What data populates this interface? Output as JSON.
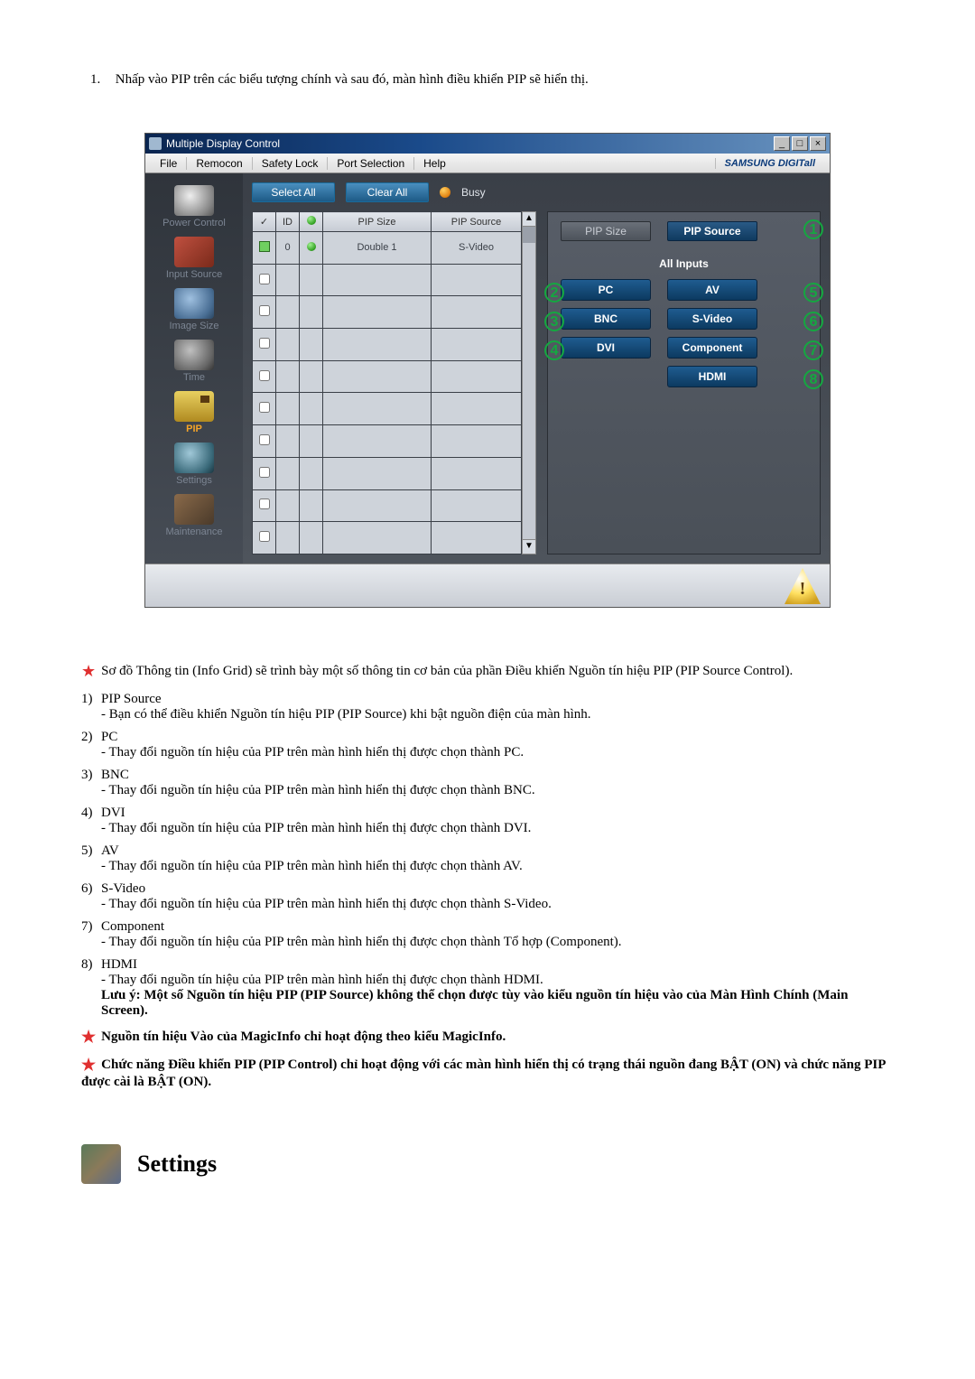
{
  "intro": {
    "num": "1.",
    "text": "Nhấp vào PIP trên các biểu tượng chính và sau đó, màn hình điều khiển PIP sẽ hiển thị."
  },
  "app": {
    "title": "Multiple Display Control",
    "menus": {
      "file": "File",
      "remocon": "Remocon",
      "safety_lock": "Safety Lock",
      "port_selection": "Port Selection",
      "help": "Help"
    },
    "brand": "SAMSUNG DIGITall",
    "winbuttons": {
      "min": "_",
      "max": "□",
      "close": "×"
    },
    "sidebar": {
      "power": "Power Control",
      "input": "Input Source",
      "imgsize": "Image Size",
      "time": "Time",
      "pip": "PIP",
      "settings": "Settings",
      "maintenance": "Maintenance"
    },
    "toolbar": {
      "select_all": "Select All",
      "clear_all": "Clear All",
      "busy": "Busy"
    },
    "grid": {
      "headers": {
        "chk": "✓",
        "id": "ID",
        "status": "●",
        "pip_size": "PIP Size",
        "pip_source": "PIP Source"
      },
      "row0": {
        "id": "0",
        "pip_size": "Double 1",
        "pip_source": "S-Video"
      }
    },
    "rightpane": {
      "tab_size": "PIP Size",
      "tab_source": "PIP Source",
      "all_inputs": "All Inputs",
      "btns": {
        "pc": "PC",
        "av": "AV",
        "bnc": "BNC",
        "svideo": "S-Video",
        "dvi": "DVI",
        "component": "Component",
        "hdmi": "HDMI"
      },
      "callouts": {
        "c1": "1",
        "c2": "2",
        "c3": "3",
        "c4": "4",
        "c5": "5",
        "c6": "6",
        "c7": "7",
        "c8": "8"
      }
    }
  },
  "notes": {
    "star_intro": "Sơ đồ Thông tin (Info Grid) sẽ trình bày một số thông tin cơ bản của phần Điều khiển Nguồn tín hiệu PIP (PIP Source Control).",
    "items": {
      "n1": {
        "num": "1)",
        "title": "PIP Source",
        "sub": "- Bạn có thể điều khiển Nguồn tín hiệu PIP (PIP Source) khi bật nguồn điện của màn hình."
      },
      "n2": {
        "num": "2)",
        "title": "PC",
        "sub": "- Thay đổi nguồn tín hiệu của PIP trên màn hình hiển thị được chọn thành PC."
      },
      "n3": {
        "num": "3)",
        "title": "BNC",
        "sub": "- Thay đổi nguồn tín hiệu của PIP trên màn hình hiển thị được chọn thành BNC."
      },
      "n4": {
        "num": "4)",
        "title": "DVI",
        "sub": "- Thay đổi nguồn tín hiệu của PIP trên màn hình hiển thị được chọn thành DVI."
      },
      "n5": {
        "num": "5)",
        "title": "AV",
        "sub": "- Thay đổi nguồn tín hiệu của PIP trên màn hình hiển thị được chọn thành AV."
      },
      "n6": {
        "num": "6)",
        "title": "S-Video",
        "sub": "- Thay đổi nguồn tín hiệu của PIP trên màn hình hiển thị được chọn thành S-Video."
      },
      "n7": {
        "num": "7)",
        "title": "Component",
        "sub": "- Thay đổi nguồn tín hiệu của PIP trên màn hình hiển thị được chọn thành Tổ hợp (Component)."
      },
      "n8": {
        "num": "8)",
        "title": "HDMI",
        "sub": "- Thay đổi nguồn tín hiệu của PIP trên màn hình hiển thị được chọn thành HDMI."
      }
    },
    "warning": "Lưu ý: Một số Nguồn tín hiệu PIP (PIP Source) không thể chọn được tùy vào kiểu nguồn tín hiệu vào của Màn Hình Chính (Main Screen).",
    "star_magicinfo": "Nguồn tín hiệu Vào của MagicInfo chỉ hoạt động theo kiểu MagicInfo.",
    "star_pipcontrol": "Chức năng Điều khiển PIP (PIP Control) chỉ hoạt động với các màn hình hiển thị có trạng thái nguồn đang BẬT (ON) và chức năng PIP được cài là BẬT (ON)."
  },
  "settings_heading": "Settings"
}
